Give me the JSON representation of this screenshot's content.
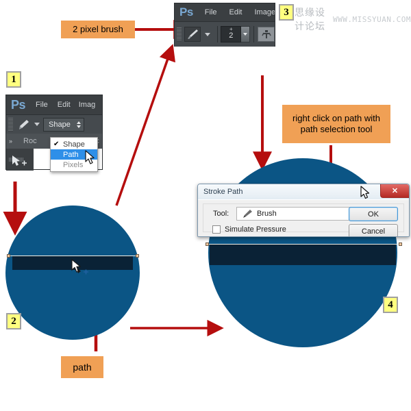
{
  "badges": [
    {
      "id": "1",
      "label": "1"
    },
    {
      "id": "2",
      "label": "2"
    },
    {
      "id": "3",
      "label": "3"
    },
    {
      "id": "4",
      "label": "4"
    }
  ],
  "callouts": {
    "brush": "2 pixel brush",
    "rightclick_line1": "right click on path with",
    "rightclick_line2": "path selection tool",
    "path": "path"
  },
  "watermark": {
    "cn": "思缘设计论坛",
    "en": "WWW.MISSYUAN.COM"
  },
  "top_toolbar": {
    "logo": "Ps",
    "menu": [
      "File",
      "Edit",
      "Image"
    ],
    "brush_size": "2",
    "size_plus": "+",
    "icons": {
      "brush": "brush-icon",
      "airbrush": "airbrush-icon",
      "caret": "chevron-down-icon"
    }
  },
  "step1_panel": {
    "logo": "Ps",
    "menu": [
      "File",
      "Edit",
      "Imag"
    ],
    "tool_icon": "pen-tool-icon",
    "mode_combo": "Shape",
    "doc_tab": "Roc",
    "doc_tab_tail": "sc",
    "move_tool_icon": "path-selection-tool-icon",
    "dropdown": [
      {
        "label": "Shape",
        "checked": true,
        "selected": false
      },
      {
        "label": "Path",
        "checked": false,
        "selected": true
      },
      {
        "label": "Pixels",
        "checked": false,
        "selected": false
      }
    ],
    "check_glyph": "✔"
  },
  "dialog": {
    "title": "Stroke Path",
    "close_label": "✕",
    "tool_label": "Tool:",
    "tool_value": "Brush",
    "tool_icon": "brush-icon",
    "checkbox_label": "Simulate Pressure",
    "checkbox_checked": false,
    "ok_label": "OK",
    "cancel_label": "Cancel"
  },
  "canvas": {
    "left_circle_name": "shape-circle-with-path",
    "right_circle_name": "shape-circle-stroked",
    "cursor_left": "path-selection-cursor",
    "cursor_dialog": "mouse-pointer"
  },
  "colors": {
    "circle_blue": "#0b5585",
    "band_dark": "#0a2236",
    "arrow_red": "#b50e0e",
    "callout_orange": "#f0a055",
    "badge_yellow": "#ffff80",
    "ps_chrome": "#3b3f42",
    "highlight_blue": "#2e8fe8"
  }
}
